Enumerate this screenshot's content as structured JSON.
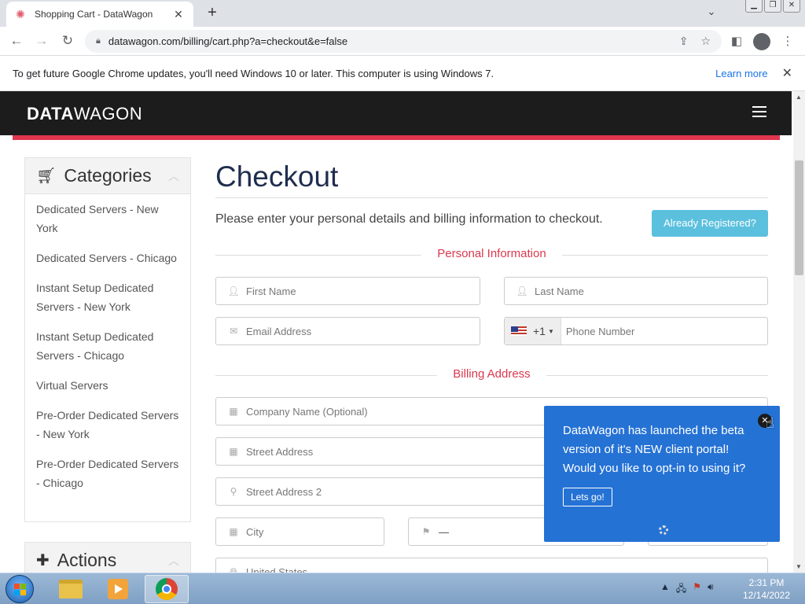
{
  "browser": {
    "tab_title": "Shopping Cart - DataWagon",
    "tab_close": "✕",
    "new_tab": "+",
    "url": "datawagon.com/billing/cart.php?a=checkout&e=false"
  },
  "infobar": {
    "message": "To get future Google Chrome updates, you'll need Windows 10 or later. This computer is using Windows 7.",
    "learn_more": "Learn more",
    "close": "✕"
  },
  "site": {
    "logo_bold": "DATA",
    "logo_light": "WAGON"
  },
  "sidebar": {
    "categories_title": "Categories",
    "items": [
      "Dedicated Servers - New York",
      "Dedicated Servers - Chicago",
      "Instant Setup Dedicated Servers - New York",
      "Instant Setup Dedicated Servers - Chicago",
      "Virtual Servers",
      "Pre-Order Dedicated Servers - New York",
      "Pre-Order Dedicated Servers - Chicago"
    ],
    "actions_title": "Actions"
  },
  "checkout": {
    "title": "Checkout",
    "intro": "Please enter your personal details and billing information to checkout.",
    "already_registered": "Already Registered?",
    "personal_section": "Personal Information",
    "billing_section": "Billing Address",
    "fields": {
      "first_name": "First Name",
      "last_name": "Last Name",
      "email": "Email Address",
      "phone_code": "+1",
      "phone": "Phone Number",
      "company": "Company Name (Optional)",
      "street": "Street Address",
      "street2": "Street Address 2",
      "city": "City",
      "state": "—",
      "country": "United States"
    }
  },
  "popup": {
    "message": "DataWagon has launched the beta version of it's NEW client portal! Would you like to opt-in to using it?",
    "button": "Lets go!",
    "close": "✕"
  },
  "taskbar": {
    "time": "2:31 PM",
    "date": "12/14/2022"
  },
  "colors": {
    "accent_red": "#e0364e",
    "popup_blue": "#2572d5",
    "info_button": "#5bc0de"
  }
}
